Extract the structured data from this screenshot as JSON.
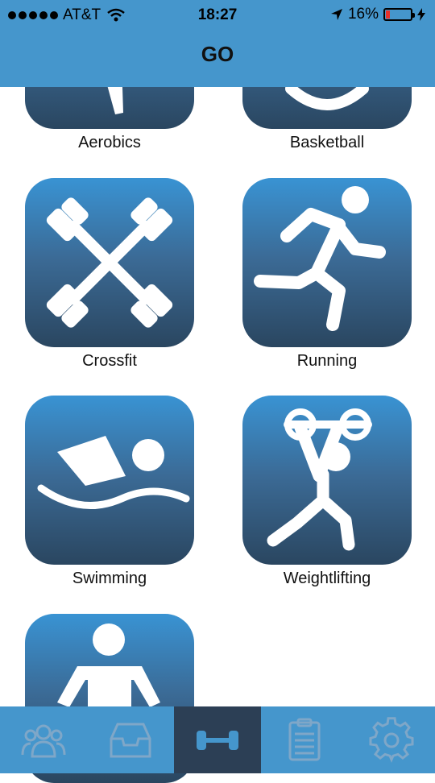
{
  "status_bar": {
    "carrier": "AT&T",
    "time": "18:27",
    "battery_percent": "16%",
    "battery_level": 0.16,
    "battery_color": "#e8312a"
  },
  "nav": {
    "title": "GO"
  },
  "activities": [
    {
      "label": "Aerobics",
      "icon": "aerobics-icon"
    },
    {
      "label": "Basketball",
      "icon": "basketball-icon"
    },
    {
      "label": "Crossfit",
      "icon": "crossfit-icon"
    },
    {
      "label": "Running",
      "icon": "running-icon"
    },
    {
      "label": "Swimming",
      "icon": "swimming-icon"
    },
    {
      "label": "Weightlifting",
      "icon": "weightlifting-icon"
    },
    {
      "label": "",
      "icon": "yoga-icon"
    }
  ],
  "tabbar": {
    "tabs": [
      {
        "icon": "community-icon",
        "active": false
      },
      {
        "icon": "inbox-icon",
        "active": false
      },
      {
        "icon": "dumbbell-icon",
        "active": true
      },
      {
        "icon": "clipboard-icon",
        "active": false
      },
      {
        "icon": "gear-icon",
        "active": false
      }
    ],
    "active_color": "#2c3f55",
    "background_color": "#4596cc"
  },
  "colors": {
    "header": "#4596cc",
    "tile_top": "#3993d3",
    "tile_bottom": "#2a4660"
  }
}
